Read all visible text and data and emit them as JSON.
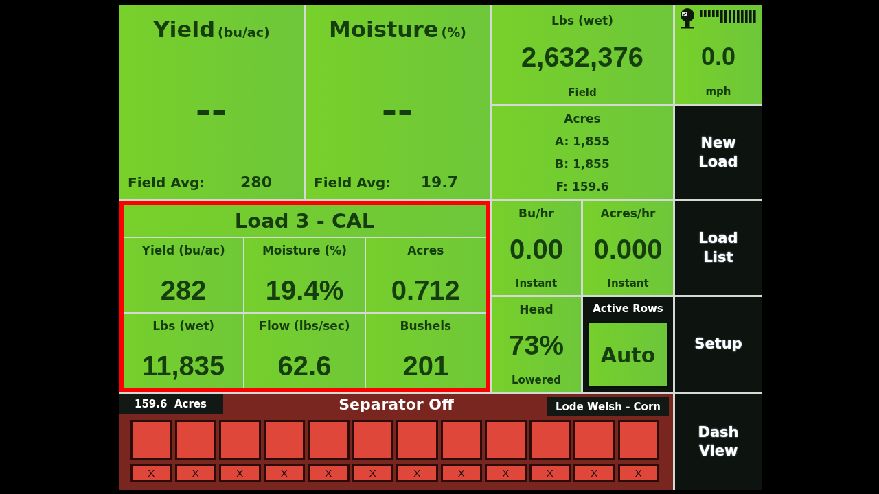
{
  "average_tiles": [
    {
      "title": "Yield",
      "unit": "(bu/ac)",
      "value": "--",
      "avg_label": "Field Avg:",
      "avg_value": "280"
    },
    {
      "title": "Moisture",
      "unit": "(%)",
      "value": "--",
      "avg_label": "Field Avg:",
      "avg_value": "19.7"
    }
  ],
  "lbs_tile": {
    "label": "Lbs (wet)",
    "value": "2,632,376",
    "caption": "Field"
  },
  "speed_tile": {
    "value": "0.0",
    "unit": "mph"
  },
  "acres_tile": {
    "label": "Acres",
    "lines": [
      "A: 1,855",
      "B: 1,855",
      "F: 159.6"
    ]
  },
  "load_panel": {
    "highlighted": true,
    "title": "Load 3 - CAL",
    "stats": [
      {
        "label": "Yield (bu/ac)",
        "value": "282"
      },
      {
        "label": "Moisture (%)",
        "value": "19.4%"
      },
      {
        "label": "Acres",
        "value": "0.712"
      },
      {
        "label": "Lbs (wet)",
        "value": "11,835"
      },
      {
        "label": "Flow (lbs/sec)",
        "value": "62.6"
      },
      {
        "label": "Bushels",
        "value": "201"
      }
    ]
  },
  "instant_tiles": [
    {
      "label": "Bu/hr",
      "value": "0.00",
      "caption": "Instant"
    },
    {
      "label": "Acres/hr",
      "value": "0.000",
      "caption": "Instant"
    }
  ],
  "head_tile": {
    "label": "Head",
    "value": "73%",
    "caption": "Lowered"
  },
  "active_rows": {
    "label": "Active Rows",
    "mode": "Auto"
  },
  "separator_panel": {
    "acres": "159.6  Acres",
    "status": "Separator Off",
    "field": "Lode Welsh - Corn",
    "rows": [
      {
        "on": false,
        "mark": "X"
      },
      {
        "on": false,
        "mark": "X"
      },
      {
        "on": false,
        "mark": "X"
      },
      {
        "on": false,
        "mark": "X"
      },
      {
        "on": false,
        "mark": "X"
      },
      {
        "on": false,
        "mark": "X"
      },
      {
        "on": false,
        "mark": "X"
      },
      {
        "on": false,
        "mark": "X"
      },
      {
        "on": false,
        "mark": "X"
      },
      {
        "on": false,
        "mark": "X"
      },
      {
        "on": false,
        "mark": "X"
      },
      {
        "on": false,
        "mark": "X"
      }
    ]
  },
  "side_buttons": [
    {
      "label": "New Load"
    },
    {
      "label": "Load List"
    },
    {
      "label": "Setup"
    },
    {
      "label": "Dash View"
    }
  ]
}
